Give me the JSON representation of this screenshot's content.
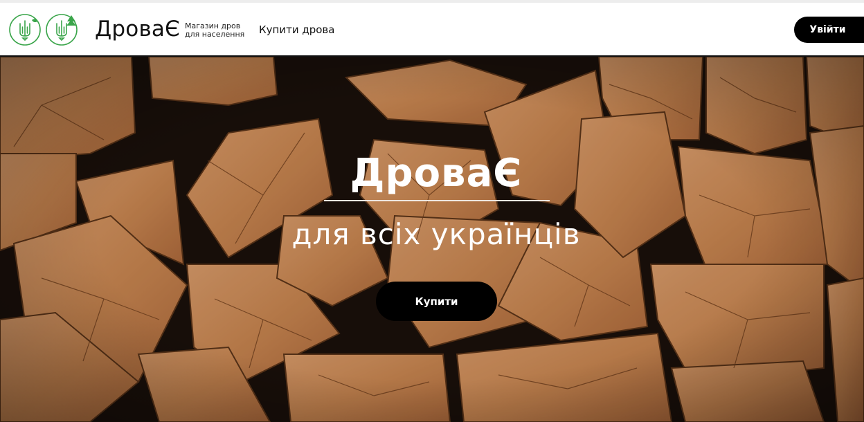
{
  "header": {
    "brand": "ДроваЄ",
    "tagline_line1": "Магазин дров",
    "tagline_line2": "для населення",
    "nav_buy_firewood": "Купити дрова",
    "login_label": "Увійти"
  },
  "hero": {
    "title": "ДроваЄ",
    "subtitle": "для всіх українців",
    "buy_label": "Купити"
  },
  "colors": {
    "brand_green": "#3aa54a",
    "button_black": "#000000",
    "wood": "#c98a58"
  },
  "icons": [
    "trident-emblem-icon",
    "trident-tree-emblem-icon"
  ]
}
